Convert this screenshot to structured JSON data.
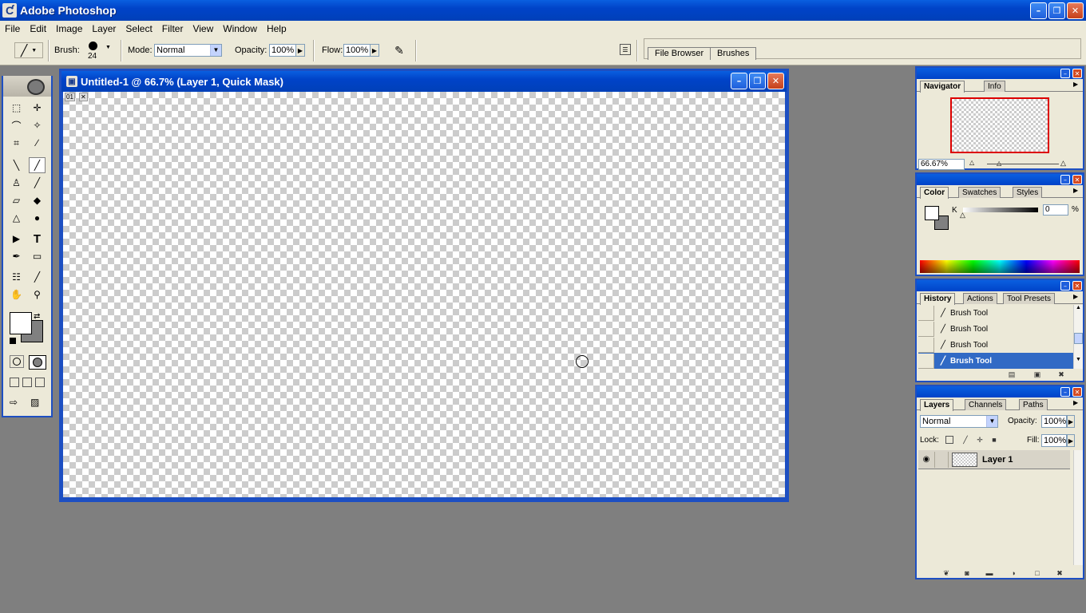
{
  "app": {
    "title": "Adobe Photoshop",
    "logo_glyph": "Ƈ"
  },
  "window_controls": {
    "minimize": "–",
    "restore": "❐",
    "close": "✕"
  },
  "menu": [
    "File",
    "Edit",
    "Image",
    "Layer",
    "Select",
    "Filter",
    "View",
    "Window",
    "Help"
  ],
  "options": {
    "brush_label": "Brush:",
    "brush_size": "24",
    "mode_label": "Mode:",
    "mode_value": "Normal",
    "opacity_label": "Opacity:",
    "opacity_value": "100%",
    "flow_label": "Flow:",
    "flow_value": "100%",
    "well_tabs": [
      "File Browser",
      "Brushes"
    ]
  },
  "document": {
    "title": "Untitled-1 @ 66.7% (Layer 1, Quick Mask)",
    "ruler_marks": [
      "01",
      "✕"
    ]
  },
  "navigator": {
    "tabs": [
      "Navigator",
      "Info"
    ],
    "zoom": "66.67%"
  },
  "color": {
    "tabs": [
      "Color",
      "Swatches",
      "Styles"
    ],
    "channel": "K",
    "value": "0",
    "unit": "%"
  },
  "history": {
    "tabs": [
      "History",
      "Actions",
      "Tool Presets"
    ],
    "items": [
      "Brush Tool",
      "Brush Tool",
      "Brush Tool",
      "Brush Tool"
    ],
    "selected_index": 3
  },
  "layers": {
    "tabs": [
      "Layers",
      "Channels",
      "Paths"
    ],
    "blend_mode": "Normal",
    "opacity_label": "Opacity:",
    "opacity_value": "100%",
    "lock_label": "Lock:",
    "fill_label": "Fill:",
    "fill_value": "100%",
    "layer_name": "Layer 1"
  },
  "colors": {
    "title_blue": "#0043c8",
    "panel_bg": "#ece9d8",
    "selection": "#316ac5"
  }
}
